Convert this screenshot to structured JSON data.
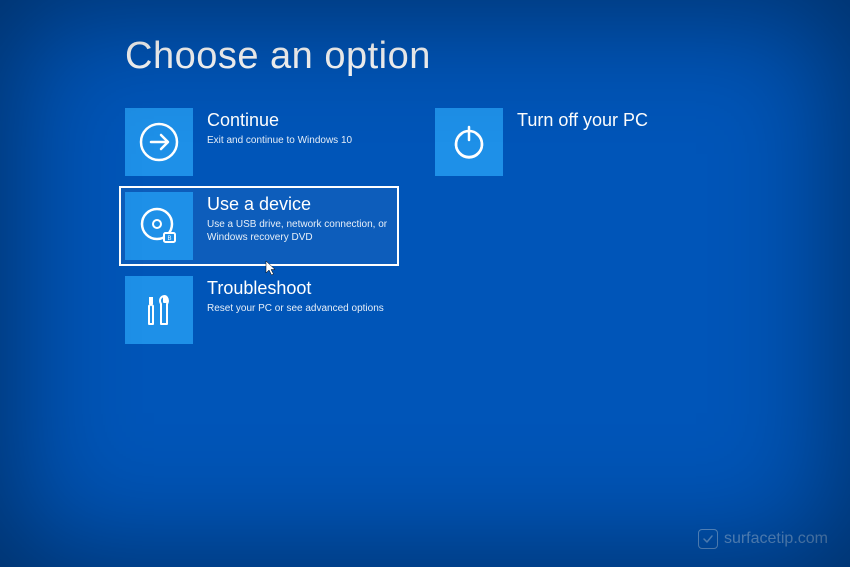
{
  "title": "Choose an option",
  "options": {
    "continue": {
      "title": "Continue",
      "desc": "Exit and continue to Windows 10"
    },
    "useDevice": {
      "title": "Use a device",
      "desc": "Use a USB drive, network connection, or Windows recovery DVD"
    },
    "troubleshoot": {
      "title": "Troubleshoot",
      "desc": "Reset your PC or see advanced options"
    },
    "turnOff": {
      "title": "Turn off your PC"
    }
  },
  "watermark": "surfacetip.com"
}
